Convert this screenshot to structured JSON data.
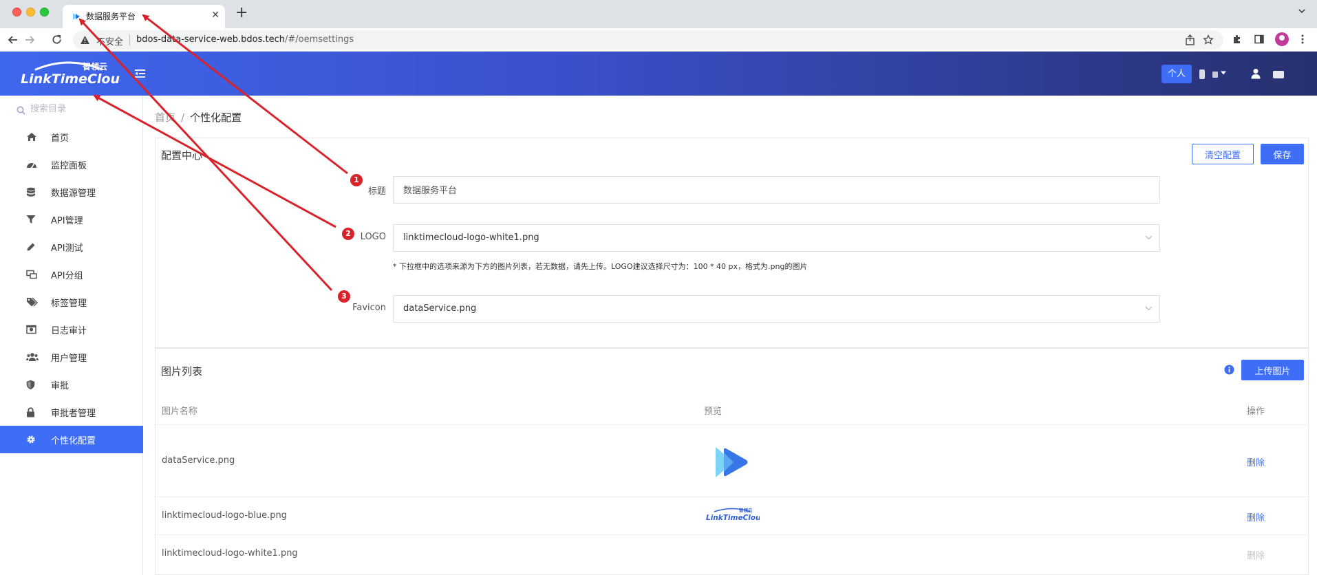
{
  "browser": {
    "tab_title": "数据服务平台",
    "security_label": "不安全",
    "url_host": "bdos-data-service-web.bdos.tech",
    "url_path": "/#/oemsettings"
  },
  "header": {
    "logo_text": "LinkTimeCloud 智领云",
    "personal_label": "个人"
  },
  "sidebar": {
    "search_placeholder": "搜索目录",
    "items": [
      {
        "label": "首页",
        "icon": "home-icon"
      },
      {
        "label": "监控面板",
        "icon": "dashboard-icon"
      },
      {
        "label": "数据源管理",
        "icon": "database-icon"
      },
      {
        "label": "API管理",
        "icon": "filter-icon"
      },
      {
        "label": "API测试",
        "icon": "pen-icon"
      },
      {
        "label": "API分组",
        "icon": "group-icon"
      },
      {
        "label": "标签管理",
        "icon": "tags-icon"
      },
      {
        "label": "日志审计",
        "icon": "log-icon"
      },
      {
        "label": "用户管理",
        "icon": "users-icon"
      },
      {
        "label": "审批",
        "icon": "shield-icon"
      },
      {
        "label": "审批者管理",
        "icon": "lock-icon"
      },
      {
        "label": "个性化配置",
        "icon": "gear-icon",
        "active": true
      }
    ]
  },
  "breadcrumb": {
    "home": "首页",
    "separator": "/",
    "current": "个性化配置"
  },
  "config": {
    "title": "配置中心",
    "clear_label": "清空配置",
    "save_label": "保存",
    "fields": {
      "title_label": "标题",
      "title_value": "数据服务平台",
      "logo_label": "LOGO",
      "logo_value": "linktimecloud-logo-white1.png",
      "hint": "* 下拉框中的选项来源为下方的图片列表，若无数据，请先上传。LOGO建议选择尺寸为：100 * 40 px，格式为.png的图片",
      "favicon_label": "Favicon",
      "favicon_value": "dataService.png"
    }
  },
  "image_list": {
    "title": "图片列表",
    "upload_label": "上传图片",
    "columns": [
      "图片名称",
      "预览",
      "操作"
    ],
    "rows": [
      {
        "name": "dataService.png",
        "action": "删除"
      },
      {
        "name": "linktimecloud-logo-blue.png",
        "action": "删除"
      },
      {
        "name": "linktimecloud-logo-white1.png",
        "action": "删除",
        "disabled": true
      }
    ]
  },
  "annotations": [
    "1",
    "2",
    "3"
  ],
  "colors": {
    "primary": "#3d6ef5",
    "annotation_red": "#d9232b"
  }
}
